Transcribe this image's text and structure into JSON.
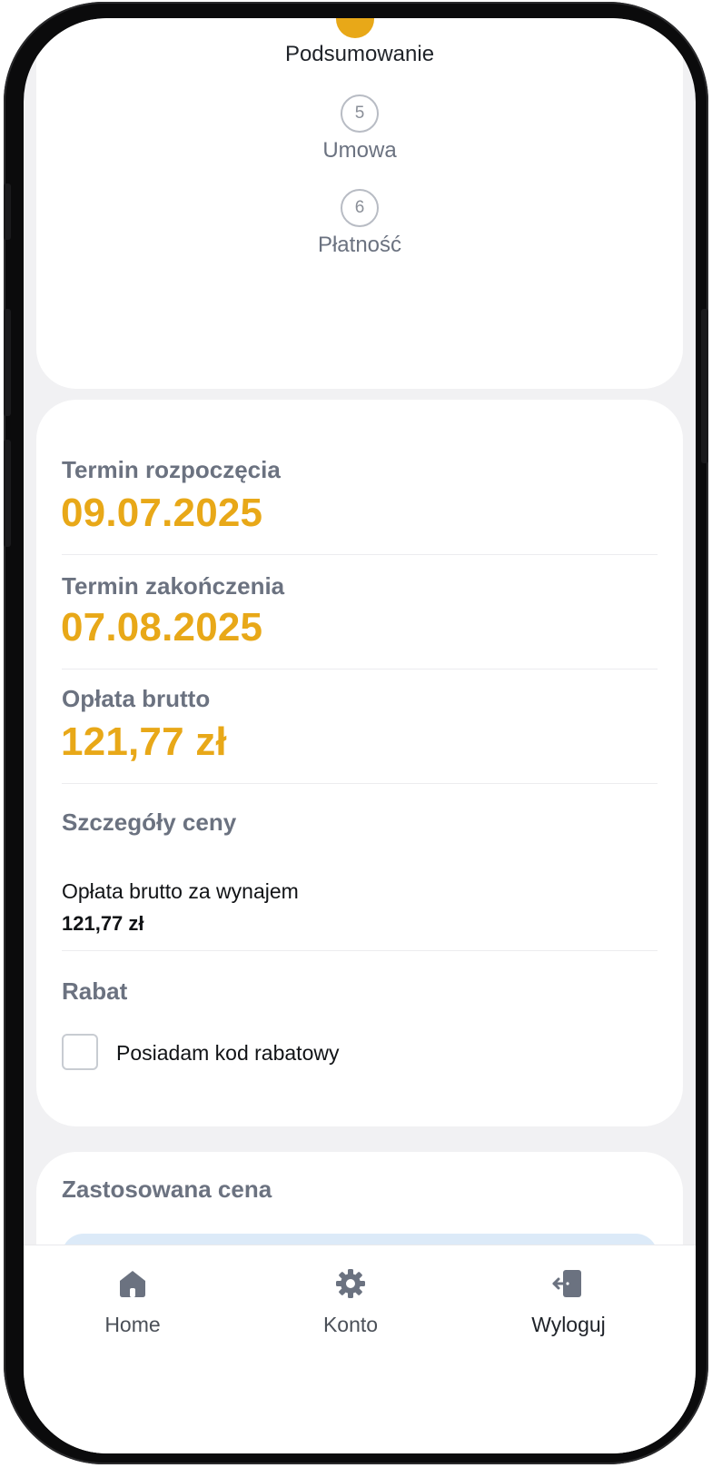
{
  "stepper": {
    "current_label": "Podsumowanie",
    "steps": [
      {
        "number": "5",
        "label": "Umowa"
      },
      {
        "number": "6",
        "label": "Płatność"
      }
    ]
  },
  "summary": {
    "start_label": "Termin rozpoczęcia",
    "start_value": "09.07.2025",
    "end_label": "Termin zakończenia",
    "end_value": "07.08.2025",
    "fee_label": "Opłata brutto",
    "fee_value": "121,77 zł",
    "price_details_heading": "Szczegóły ceny",
    "rental_fee_label": "Opłata brutto za wynajem",
    "rental_fee_value": "121,77 zł",
    "discount_heading": "Rabat",
    "discount_checkbox_label": "Posiadam kod rabatowy"
  },
  "applied": {
    "heading": "Zastosowana cena"
  },
  "nav": {
    "home": {
      "label": "Home",
      "icon": "home-icon"
    },
    "konto": {
      "label": "Konto",
      "icon": "gear-icon"
    },
    "logout": {
      "label": "Wyloguj",
      "icon": "logout-icon"
    }
  },
  "colors": {
    "accent": "#e8a818",
    "muted": "#6b7280",
    "nav_icon": "#6b7280"
  }
}
